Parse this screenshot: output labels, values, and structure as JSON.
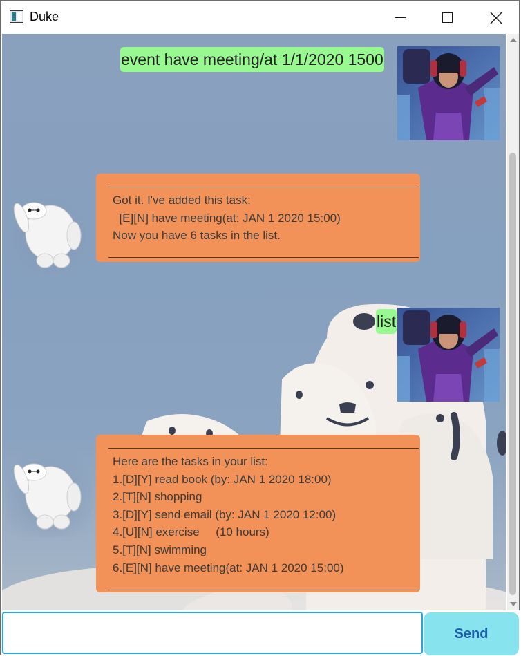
{
  "window": {
    "title": "Duke"
  },
  "messages": [
    {
      "sender": "user",
      "text": "event have meeting/at 1/1/2020 1500"
    },
    {
      "sender": "duke",
      "lines": [
        "Got it. I've added this task:",
        "  [E][N] have meeting(at: JAN 1 2020 15:00)",
        "Now you have 6 tasks in the list."
      ]
    },
    {
      "sender": "user",
      "text": "list"
    },
    {
      "sender": "duke",
      "lines": [
        "Here are the tasks in your list:",
        "1.[D][Y] read book (by: JAN 1 2020 18:00)",
        "2.[T][N] shopping",
        "3.[D][Y] send email (by: JAN 1 2020 12:00)",
        "4.[U][N] exercise     (10 hours)",
        "5.[T][N] swimming",
        "6.[E][N] have meeting(at: JAN 1 2020 15:00)"
      ]
    }
  ],
  "input": {
    "value": "",
    "placeholder": ""
  },
  "send_button": {
    "label": "Send"
  },
  "colors": {
    "user_bubble": "#98f990",
    "duke_bubble": "#f29258",
    "send_button": "#87e3ed",
    "send_label": "#1f5eaa",
    "input_border": "#27a7d6"
  },
  "icons": {
    "user_avatar": "hero-avatar",
    "duke_avatar": "robot-avatar"
  }
}
